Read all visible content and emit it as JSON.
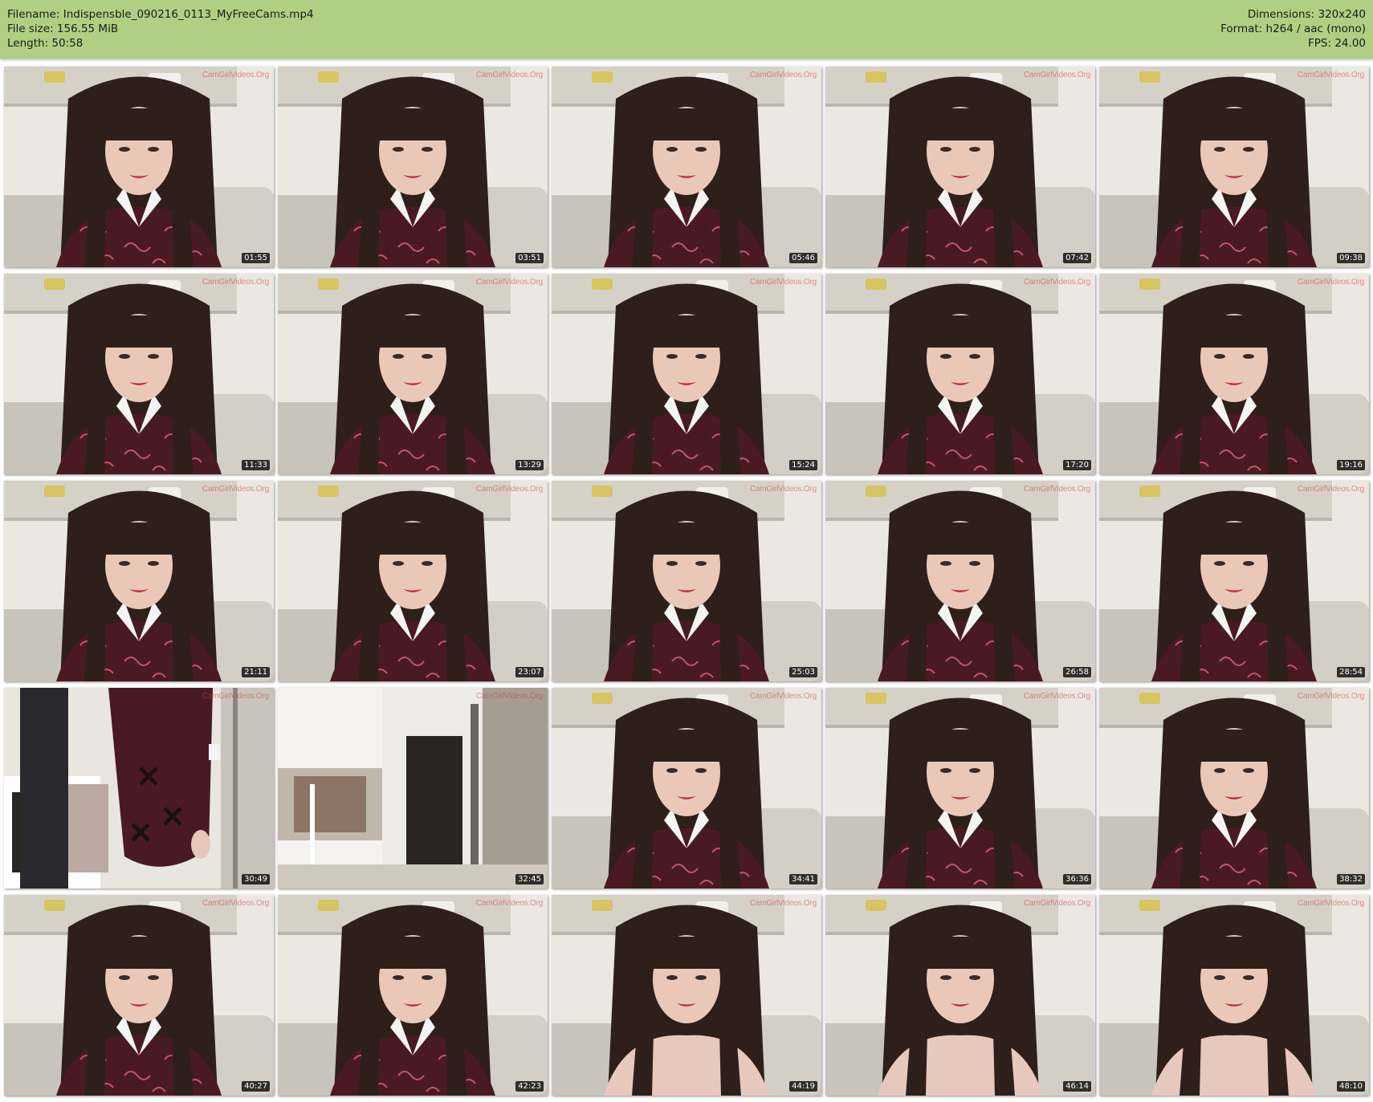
{
  "header": {
    "filename": "Filename: Indispensble_090216_0113_MyFreeCams.mp4",
    "file_size": "File size: 156.55 MiB",
    "length": "Length: 50:58",
    "dimensions": "Dimensions: 320x240",
    "format": "Format: h264 / aac (mono)",
    "fps": "FPS: 24.00"
  },
  "watermark": "CamGirlVideos.Org",
  "thumbnails": [
    {
      "time": "01:55",
      "scene": "portrait-dress"
    },
    {
      "time": "03:51",
      "scene": "portrait-dress"
    },
    {
      "time": "05:46",
      "scene": "portrait-dress"
    },
    {
      "time": "07:42",
      "scene": "portrait-dress"
    },
    {
      "time": "09:38",
      "scene": "portrait-dress"
    },
    {
      "time": "11:33",
      "scene": "portrait-dress"
    },
    {
      "time": "13:29",
      "scene": "portrait-dress"
    },
    {
      "time": "15:24",
      "scene": "portrait-dress"
    },
    {
      "time": "17:20",
      "scene": "portrait-dress"
    },
    {
      "time": "19:16",
      "scene": "portrait-dress"
    },
    {
      "time": "21:11",
      "scene": "portrait-dress"
    },
    {
      "time": "23:07",
      "scene": "portrait-dress"
    },
    {
      "time": "25:03",
      "scene": "portrait-dress"
    },
    {
      "time": "26:58",
      "scene": "portrait-dress"
    },
    {
      "time": "28:54",
      "scene": "portrait-dress"
    },
    {
      "time": "30:49",
      "scene": "standing-closeup"
    },
    {
      "time": "32:45",
      "scene": "empty-room"
    },
    {
      "time": "34:41",
      "scene": "portrait-dress"
    },
    {
      "time": "36:36",
      "scene": "portrait-dress"
    },
    {
      "time": "38:32",
      "scene": "portrait-dress"
    },
    {
      "time": "40:27",
      "scene": "portrait-dress"
    },
    {
      "time": "42:23",
      "scene": "portrait-dress"
    },
    {
      "time": "44:19",
      "scene": "portrait-light"
    },
    {
      "time": "46:14",
      "scene": "portrait-light"
    },
    {
      "time": "48:10",
      "scene": "portrait-light"
    }
  ],
  "colors": {
    "header_bg": "#b0cf82",
    "wall": "#ebe8e1",
    "hair": "#2e1f1a",
    "dress": "#4a1a24",
    "sofa": "#c9c4bb"
  }
}
